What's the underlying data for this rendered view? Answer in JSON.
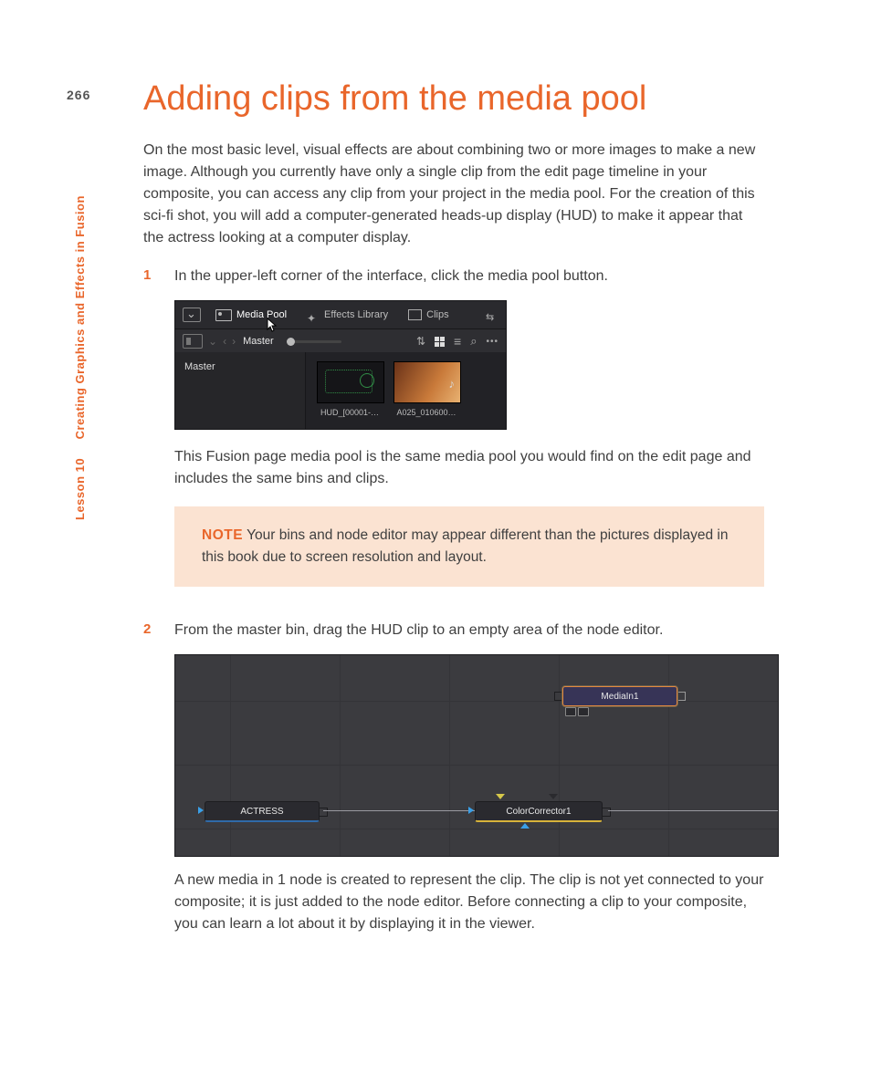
{
  "page_number": "266",
  "side_label": {
    "lesson": "Lesson 10",
    "title": "Creating Graphics and Effects in Fusion"
  },
  "heading": "Adding clips from the media pool",
  "intro": "On the most basic level, visual effects are about combining two or more images to make a new image. Although you currently have only a single clip from the edit page timeline in your composite, you can access any clip from your project in the media pool. For the creation of this sci-fi shot, you will add a computer-generated heads-up display (HUD) to make it appear that the actress looking at a computer display.",
  "steps": {
    "s1": {
      "num": "1",
      "text": "In the upper-left corner of the interface, click the media pool button.",
      "after": "This Fusion page media pool is the same media pool you would find on the edit page and includes the same bins and clips."
    },
    "s2": {
      "num": "2",
      "text": "From the master bin, drag the HUD clip to an empty area of the node editor.",
      "after": "A new media in 1 node is created to represent the clip. The clip is not yet connected to your composite; it is just added to the node editor. Before connecting a clip to your composite, you can learn a lot about it by displaying it in the viewer."
    }
  },
  "note": {
    "label": "NOTE",
    "text": " Your bins and node editor may appear different than the pictures displayed in this book due to screen resolution and layout."
  },
  "fig1": {
    "tabs": {
      "media_pool": "Media Pool",
      "effects": "Effects Library",
      "clips": "Clips"
    },
    "breadcrumb": "Master",
    "bin": "Master",
    "thumbs": {
      "a": "HUD_[00001-…",
      "b": "A025_010600…"
    }
  },
  "fig2": {
    "nodes": {
      "mediain": "MediaIn1",
      "actress": "ACTRESS",
      "cc": "ColorCorrector1"
    }
  }
}
